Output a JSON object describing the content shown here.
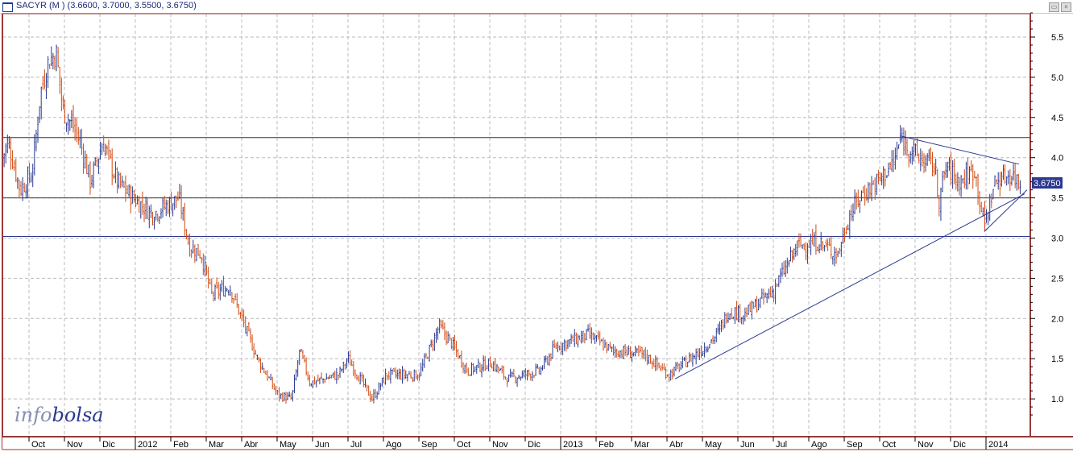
{
  "window": {
    "title": "SACYR (M ) (3.6600, 3.7000, 3.5500, 3.6750)",
    "min_button": "▭",
    "close_button": "×"
  },
  "logo": {
    "part1": "info",
    "part2": "bolsa"
  },
  "colors": {
    "up": "#2b3990",
    "down": "#d24a12",
    "frame": "#9a3a3a",
    "trend": "#2b3990",
    "label_bg": "#2b3990"
  },
  "chart_data": {
    "type": "bar",
    "subtype": "ohlc",
    "title": "SACYR (M )",
    "last": {
      "open": 3.66,
      "high": 3.7,
      "low": 3.55,
      "close": 3.675,
      "label": "3.6750"
    },
    "ylim": [
      0.7,
      5.8
    ],
    "yticks": [
      "1.0",
      "1.5",
      "2.0",
      "2.5",
      "3.0",
      "3.5",
      "4.0",
      "4.5",
      "5.0",
      "5.5"
    ],
    "ytick_values": [
      1.0,
      1.5,
      2.0,
      2.5,
      3.0,
      3.5,
      4.0,
      4.5,
      5.0,
      5.5
    ],
    "xlabel_unit": "months since Oct 2011",
    "xticks": [
      "Oct",
      "Nov",
      "Dic",
      "2012",
      "Feb",
      "Mar",
      "Abr",
      "May",
      "Jun",
      "Jul",
      "Ago",
      "Sep",
      "Oct",
      "Nov",
      "Dic",
      "2013",
      "Feb",
      "Mar",
      "Abr",
      "May",
      "Jun",
      "Jul",
      "Ago",
      "Sep",
      "Oct",
      "Nov",
      "Dic",
      "2014"
    ],
    "grid": true,
    "price_path": [
      [
        -0.75,
        4.0
      ],
      [
        -0.59,
        4.2
      ],
      [
        -0.25,
        3.6
      ],
      [
        0.09,
        3.8
      ],
      [
        0.32,
        4.8
      ],
      [
        0.55,
        5.2
      ],
      [
        0.77,
        5.3
      ],
      [
        0.95,
        4.6
      ],
      [
        1.23,
        4.4
      ],
      [
        1.45,
        4.2
      ],
      [
        1.73,
        3.7
      ],
      [
        2.09,
        4.2
      ],
      [
        2.48,
        3.7
      ],
      [
        2.93,
        3.5
      ],
      [
        3.5,
        3.3
      ],
      [
        4.23,
        3.5
      ],
      [
        4.52,
        2.9
      ],
      [
        4.86,
        2.8
      ],
      [
        5.14,
        2.3
      ],
      [
        5.66,
        2.4
      ],
      [
        6.0,
        2.0
      ],
      [
        6.45,
        1.5
      ],
      [
        7.02,
        1.05
      ],
      [
        7.41,
        1.0
      ],
      [
        7.64,
        1.6
      ],
      [
        7.93,
        1.2
      ],
      [
        8.73,
        1.3
      ],
      [
        9.0,
        1.5
      ],
      [
        9.68,
        1.0
      ],
      [
        10.09,
        1.3
      ],
      [
        11.0,
        1.3
      ],
      [
        11.57,
        1.9
      ],
      [
        11.91,
        1.7
      ],
      [
        12.36,
        1.35
      ],
      [
        13.05,
        1.45
      ],
      [
        13.5,
        1.25
      ],
      [
        14.41,
        1.35
      ],
      [
        14.86,
        1.65
      ],
      [
        15.77,
        1.8
      ],
      [
        16.45,
        1.6
      ],
      [
        17.36,
        1.55
      ],
      [
        18.05,
        1.3
      ],
      [
        18.95,
        1.6
      ],
      [
        19.41,
        1.8
      ],
      [
        19.75,
        2.1
      ],
      [
        20.2,
        2.05
      ],
      [
        21.0,
        2.35
      ],
      [
        21.68,
        2.9
      ],
      [
        22.25,
        2.95
      ],
      [
        22.82,
        2.8
      ],
      [
        23.16,
        3.3
      ],
      [
        23.5,
        3.55
      ],
      [
        23.95,
        3.7
      ],
      [
        24.41,
        3.95
      ],
      [
        24.59,
        4.25
      ],
      [
        25.09,
        4.0
      ],
      [
        25.55,
        3.9
      ],
      [
        25.66,
        3.45
      ],
      [
        25.89,
        3.9
      ],
      [
        26.23,
        3.7
      ],
      [
        26.68,
        3.85
      ],
      [
        26.95,
        3.15
      ],
      [
        27.25,
        3.7
      ],
      [
        27.7,
        3.8
      ],
      [
        28.0,
        3.675
      ]
    ],
    "horizontal_lines": [
      {
        "value": 4.25,
        "color": "#333333"
      },
      {
        "value": 3.5,
        "color": "#333333"
      },
      {
        "value": 3.02,
        "color": "#2b3990"
      }
    ],
    "trend_lines": [
      {
        "from": [
          18.23,
          1.25
        ],
        "to": [
          28.09,
          3.55
        ]
      },
      {
        "from": [
          24.59,
          4.27
        ],
        "to": [
          27.93,
          3.92
        ]
      },
      {
        "from": [
          26.95,
          3.08
        ],
        "to": [
          28.16,
          3.6
        ]
      }
    ]
  }
}
